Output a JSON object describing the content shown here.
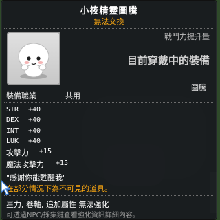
{
  "item": {
    "name": "小筱精靈圖騰",
    "trade_status": "無法交換",
    "combat_power_label": "戰鬥力提升量",
    "equipped_label": "目前穿戴中的裝備",
    "job_label": "裝備職業",
    "job_value": "共用",
    "category": "圖騰",
    "stats": [
      {
        "name": "STR",
        "value": "+40"
      },
      {
        "name": "DEX",
        "value": "+40"
      },
      {
        "name": "INT",
        "value": "+40"
      },
      {
        "name": "LUK",
        "value": "+40"
      }
    ],
    "attack_label": "攻擊力",
    "attack_value": "+15",
    "magic_attack_label": "魔法攻擊力",
    "magic_attack_value": "+15",
    "quote": "\"感謝你能甦醒我\"",
    "description": "在部分情況下為不可見的道具。",
    "enhancement": "星力, 卷軸, 追加屬性 無法強化",
    "note": "可透過NPC/採集鍵查看強化資訊詳細內容。"
  },
  "colors": {
    "title": "#ffffff",
    "trade_status": "#ffaa11",
    "description": "#ffaa11",
    "note": "#9a9a9a",
    "tooltip_bg": "#181a1e"
  },
  "icons": [
    "spirit-totem-icon",
    "cursor-icon"
  ]
}
